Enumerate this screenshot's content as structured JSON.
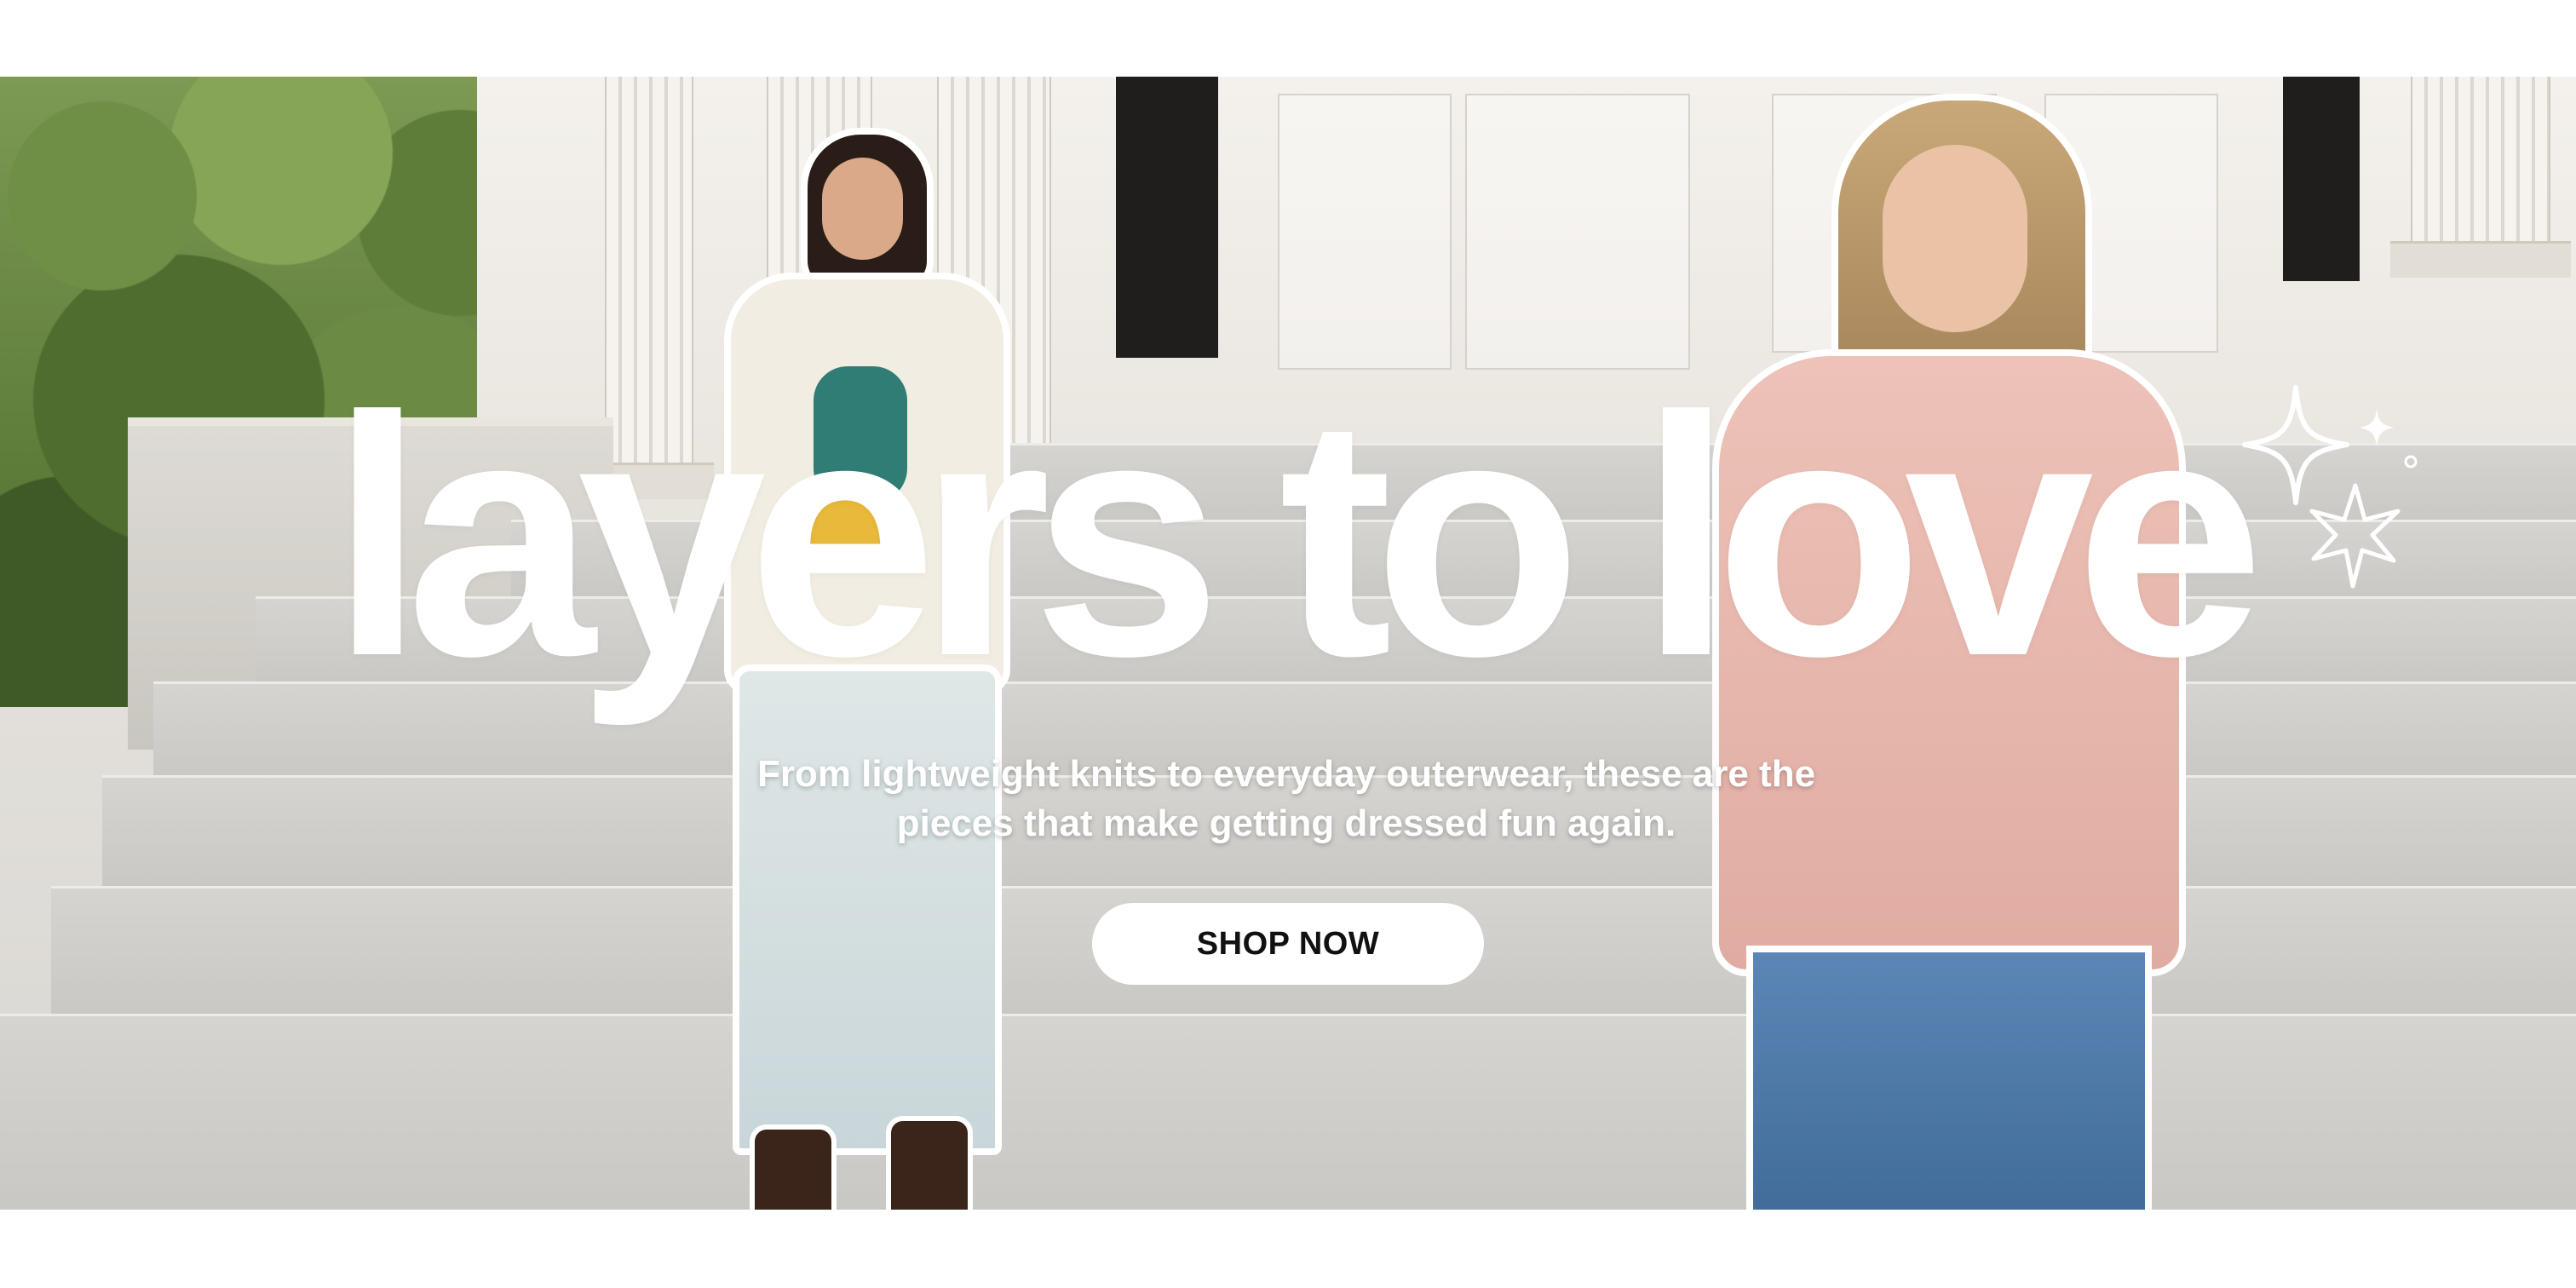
{
  "hero": {
    "headline": "layers to love",
    "subtext_line1": "From lightweight knits to everyday outerwear, these are the",
    "subtext_line2": "pieces that make getting dressed fun again.",
    "cta_label": "SHOP NOW"
  },
  "colors": {
    "page_background": "#ffffff",
    "headline": "#ffffff",
    "button_background": "#ffffff",
    "button_text": "#111111",
    "sweater_pink": "#e8b8b0",
    "denim": "#5b86b5"
  },
  "icons": [
    "sparkle-icon",
    "sparkle-small-icon",
    "starburst-icon",
    "dot-icon"
  ]
}
